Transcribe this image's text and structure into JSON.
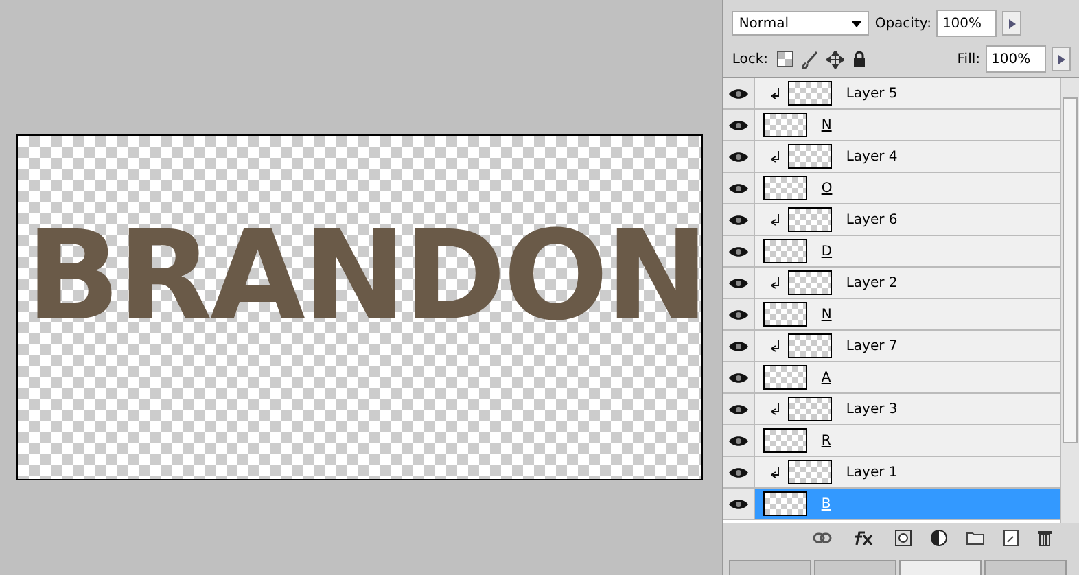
{
  "canvas": {
    "lettering": "BRANDON"
  },
  "layers_panel": {
    "blend_mode": "Normal",
    "opacity_label": "Opacity:",
    "opacity": "100%",
    "lock_label": "Lock:",
    "fill_label": "Fill:",
    "fill": "100%",
    "layers": [
      {
        "kind": "clip",
        "name": "Layer 5",
        "visible": true,
        "selected": false
      },
      {
        "kind": "shape",
        "name": "N",
        "visible": true,
        "selected": false
      },
      {
        "kind": "clip",
        "name": "Layer 4",
        "visible": true,
        "selected": false
      },
      {
        "kind": "shape",
        "name": "O",
        "visible": true,
        "selected": false
      },
      {
        "kind": "clip",
        "name": "Layer 6",
        "visible": true,
        "selected": false
      },
      {
        "kind": "shape",
        "name": "D",
        "visible": true,
        "selected": false
      },
      {
        "kind": "clip",
        "name": "Layer 2",
        "visible": true,
        "selected": false
      },
      {
        "kind": "shape",
        "name": "N",
        "visible": true,
        "selected": false
      },
      {
        "kind": "clip",
        "name": "Layer 7",
        "visible": true,
        "selected": false
      },
      {
        "kind": "shape",
        "name": "A",
        "visible": true,
        "selected": false
      },
      {
        "kind": "clip",
        "name": "Layer 3",
        "visible": true,
        "selected": false
      },
      {
        "kind": "shape",
        "name": "R",
        "visible": true,
        "selected": false
      },
      {
        "kind": "clip",
        "name": "Layer 1",
        "visible": true,
        "selected": false
      },
      {
        "kind": "shape",
        "name": "B",
        "visible": true,
        "selected": true
      }
    ],
    "bottom_tabs": [
      {
        "selected": false
      },
      {
        "selected": false
      },
      {
        "selected": true
      },
      {
        "selected": false
      }
    ]
  }
}
